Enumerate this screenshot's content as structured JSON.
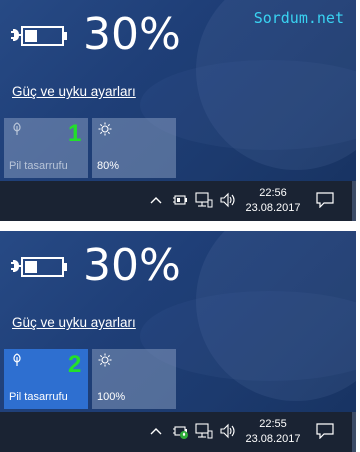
{
  "watermark": "Sordum.net",
  "panels": [
    {
      "battery_percent": "30%",
      "settings_link": "Güç ve uyku ayarları",
      "battery_saver": {
        "label": "Pil tasarrufu",
        "state": "off"
      },
      "brightness": {
        "label": "80%"
      },
      "annotation": "1",
      "clock": {
        "time": "22:56",
        "date": "23.08.2017"
      }
    },
    {
      "battery_percent": "30%",
      "settings_link": "Güç ve uyku ayarları",
      "battery_saver": {
        "label": "Pil tasarrufu",
        "state": "on"
      },
      "brightness": {
        "label": "100%"
      },
      "annotation": "2",
      "clock": {
        "time": "22:55",
        "date": "23.08.2017"
      }
    }
  ],
  "colors": {
    "panel_bg": "#1f3f78",
    "saver_on": "#2e6fd0",
    "annotation": "#22e02a",
    "watermark": "#39d3f2",
    "taskbar": "#1a2333"
  },
  "icons": {
    "battery": "battery-plug-icon",
    "saver": "leaf-icon",
    "brightness": "sun-icon",
    "chevron": "chevron-up-icon",
    "tray_battery": "battery-icon",
    "network": "network-icon",
    "volume": "volume-icon",
    "notifications": "action-center-icon"
  }
}
